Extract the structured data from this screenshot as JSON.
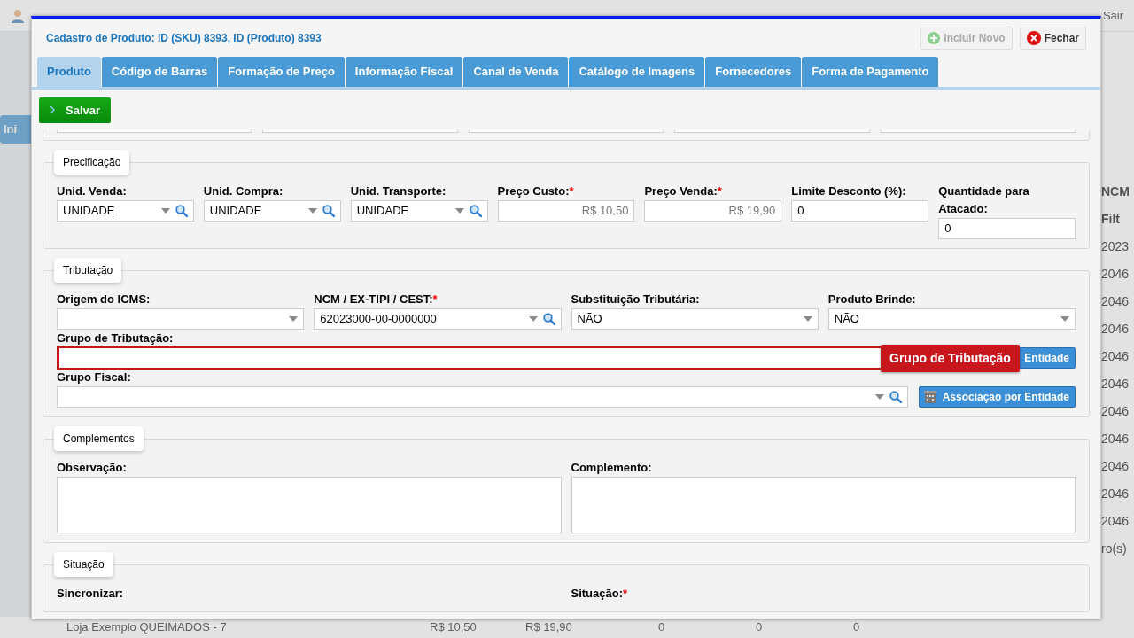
{
  "background": {
    "logout": "Sair",
    "side_tab": "Ini",
    "right_column": {
      "header": "NCM",
      "filter": "Filt",
      "cells": [
        "2023",
        "2046",
        "2046",
        "2046",
        "2046",
        "2046",
        "2046",
        "2046",
        "2046",
        "2046",
        "2046"
      ],
      "footer": "ro(s)"
    },
    "bottom_row": [
      "Loja Exemplo QUEIMADOS - 7",
      "R$ 10,50",
      "R$ 19,90",
      "0",
      "0",
      "0"
    ]
  },
  "dialog": {
    "title": "Cadastro de Produto: ID (SKU) 8393, ID (Produto) 8393",
    "buttons": [
      {
        "label": "Incluir Novo",
        "kind": "add",
        "disabled": true
      },
      {
        "label": "Fechar",
        "kind": "close",
        "disabled": false
      }
    ],
    "tabs": [
      {
        "label": "Produto",
        "selected": true
      },
      {
        "label": "Código de Barras",
        "selected": false
      },
      {
        "label": "Formação de Preço",
        "selected": false
      },
      {
        "label": "Informação Fiscal",
        "selected": false
      },
      {
        "label": "Canal de Venda",
        "selected": false
      },
      {
        "label": "Catálogo de Imagens",
        "selected": false
      },
      {
        "label": "Fornecedores",
        "selected": false
      },
      {
        "label": "Forma de Pagamento",
        "selected": false
      }
    ],
    "save_button": "Salvar",
    "partial_fields": [
      {
        "kind": "select"
      },
      {
        "kind": "select"
      },
      {
        "kind": "select"
      },
      {
        "kind": "select"
      },
      {
        "kind": "select"
      }
    ],
    "sections": [
      {
        "title": "Precificação",
        "fields": [
          {
            "label": "Unid. Venda:",
            "value": "UNIDADE",
            "kind": "select-search"
          },
          {
            "label": "Unid. Compra:",
            "value": "UNIDADE",
            "kind": "select-search"
          },
          {
            "label": "Unid. Transporte:",
            "value": "UNIDADE",
            "kind": "select-search"
          },
          {
            "label": "Preço Custo:",
            "required_mark": "*",
            "value": "R$ 10,50",
            "kind": "money"
          },
          {
            "label": "Preço Venda:",
            "required_mark": "*",
            "value": "R$ 19,90",
            "kind": "money"
          },
          {
            "label": "Limite Desconto (%):",
            "value": "0",
            "kind": "text"
          },
          {
            "label": "Quantidade para Atacado:",
            "value": "0",
            "kind": "text"
          }
        ]
      },
      {
        "title": "Tributação",
        "fields": [
          {
            "label": "Origem do ICMS:",
            "kind": "select"
          },
          {
            "label": "NCM / EX-TIPI / CEST:",
            "required_mark": "*",
            "value": "62023000-00-0000000",
            "kind": "select-search"
          },
          {
            "label": "Substituição Tributária:",
            "value": "NÃO",
            "kind": "select"
          },
          {
            "label": "Produto Brinde:",
            "value": "NÃO",
            "kind": "select"
          }
        ],
        "wide_fields": [
          {
            "label": "Grupo de Tributação:",
            "kind": "text",
            "highlighted": true,
            "tooltip": "Grupo de Tributação",
            "button": "Entidade"
          },
          {
            "label": "Grupo Fiscal:",
            "kind": "select-search",
            "highlighted": false,
            "button": "Associação por Entidade"
          }
        ]
      },
      {
        "title": "Complementos",
        "fields": [
          {
            "label": "Observação:",
            "kind": "textarea"
          },
          {
            "label": "Complemento:",
            "kind": "textarea"
          }
        ]
      },
      {
        "title": "Situação",
        "fields": [
          {
            "label": "Sincronizar:",
            "kind": "none"
          },
          {
            "label": "Situação:",
            "required_mark": "*",
            "kind": "none"
          }
        ]
      }
    ]
  }
}
